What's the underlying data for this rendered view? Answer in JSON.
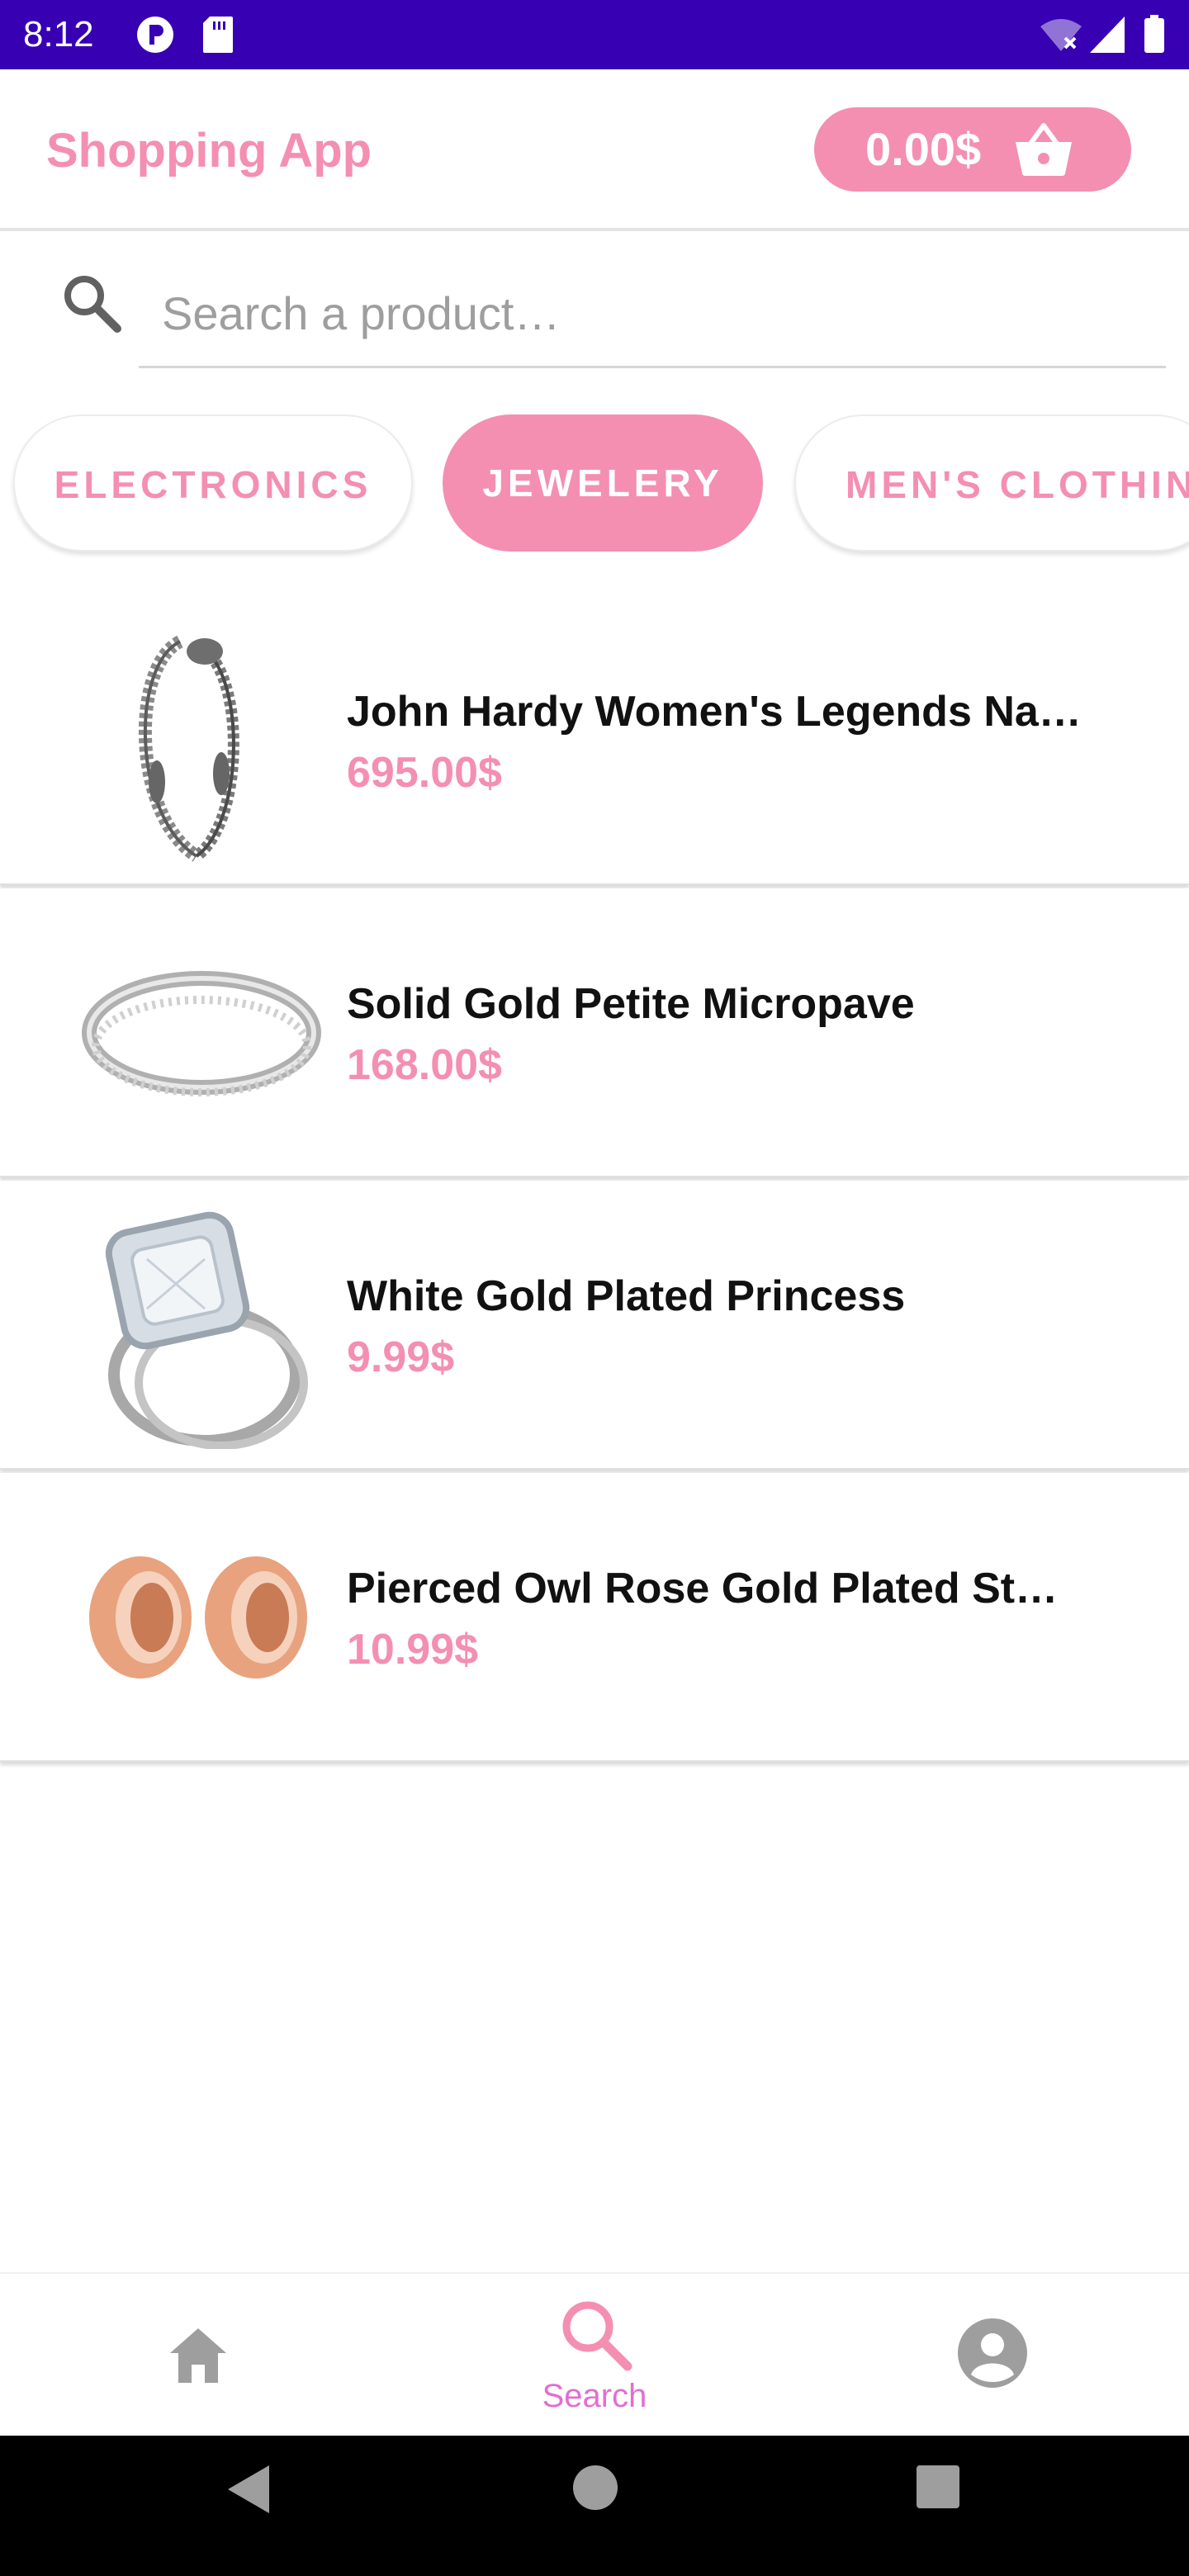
{
  "status_bar": {
    "time": "8:12",
    "icons": [
      "privacy-dot-icon",
      "sd-card-icon",
      "wifi-off-icon",
      "cell-signal-icon",
      "battery-icon"
    ]
  },
  "app_bar": {
    "title": "Shopping App",
    "cart_total": "0.00$",
    "cart_icon": "shopping-basket-icon"
  },
  "search": {
    "placeholder": "Search a product…",
    "value": "",
    "icon": "search-icon"
  },
  "categories": {
    "items": [
      "ELECTRONICS",
      "JEWELERY",
      "MEN'S CLOTHING"
    ],
    "selected": "JEWELERY"
  },
  "products": [
    {
      "name": "John Hardy Women's Legends Na…",
      "price": "695.00$",
      "image": "chain-bracelet-image"
    },
    {
      "name": "Solid Gold Petite Micropave",
      "price": "168.00$",
      "image": "eternity-band-image"
    },
    {
      "name": "White Gold Plated Princess",
      "price": "9.99$",
      "image": "cushion-cut-ring-image"
    },
    {
      "name": "Pierced Owl Rose Gold Plated St…",
      "price": "10.99$",
      "image": "rose-gold-tunnels-image"
    }
  ],
  "bottom_nav": {
    "items": [
      {
        "icon": "home-icon",
        "label": ""
      },
      {
        "icon": "search-icon",
        "label": "Search"
      },
      {
        "icon": "account-icon",
        "label": ""
      }
    ],
    "active": "Search"
  },
  "system_nav": {
    "icons": [
      "back-icon",
      "home-circle-icon",
      "recents-icon"
    ]
  },
  "colors": {
    "accent": "#f48fb1",
    "status_bar": "#3700b3",
    "nav_active": "#e06fd0",
    "nav_inactive": "#9e9e9e"
  }
}
